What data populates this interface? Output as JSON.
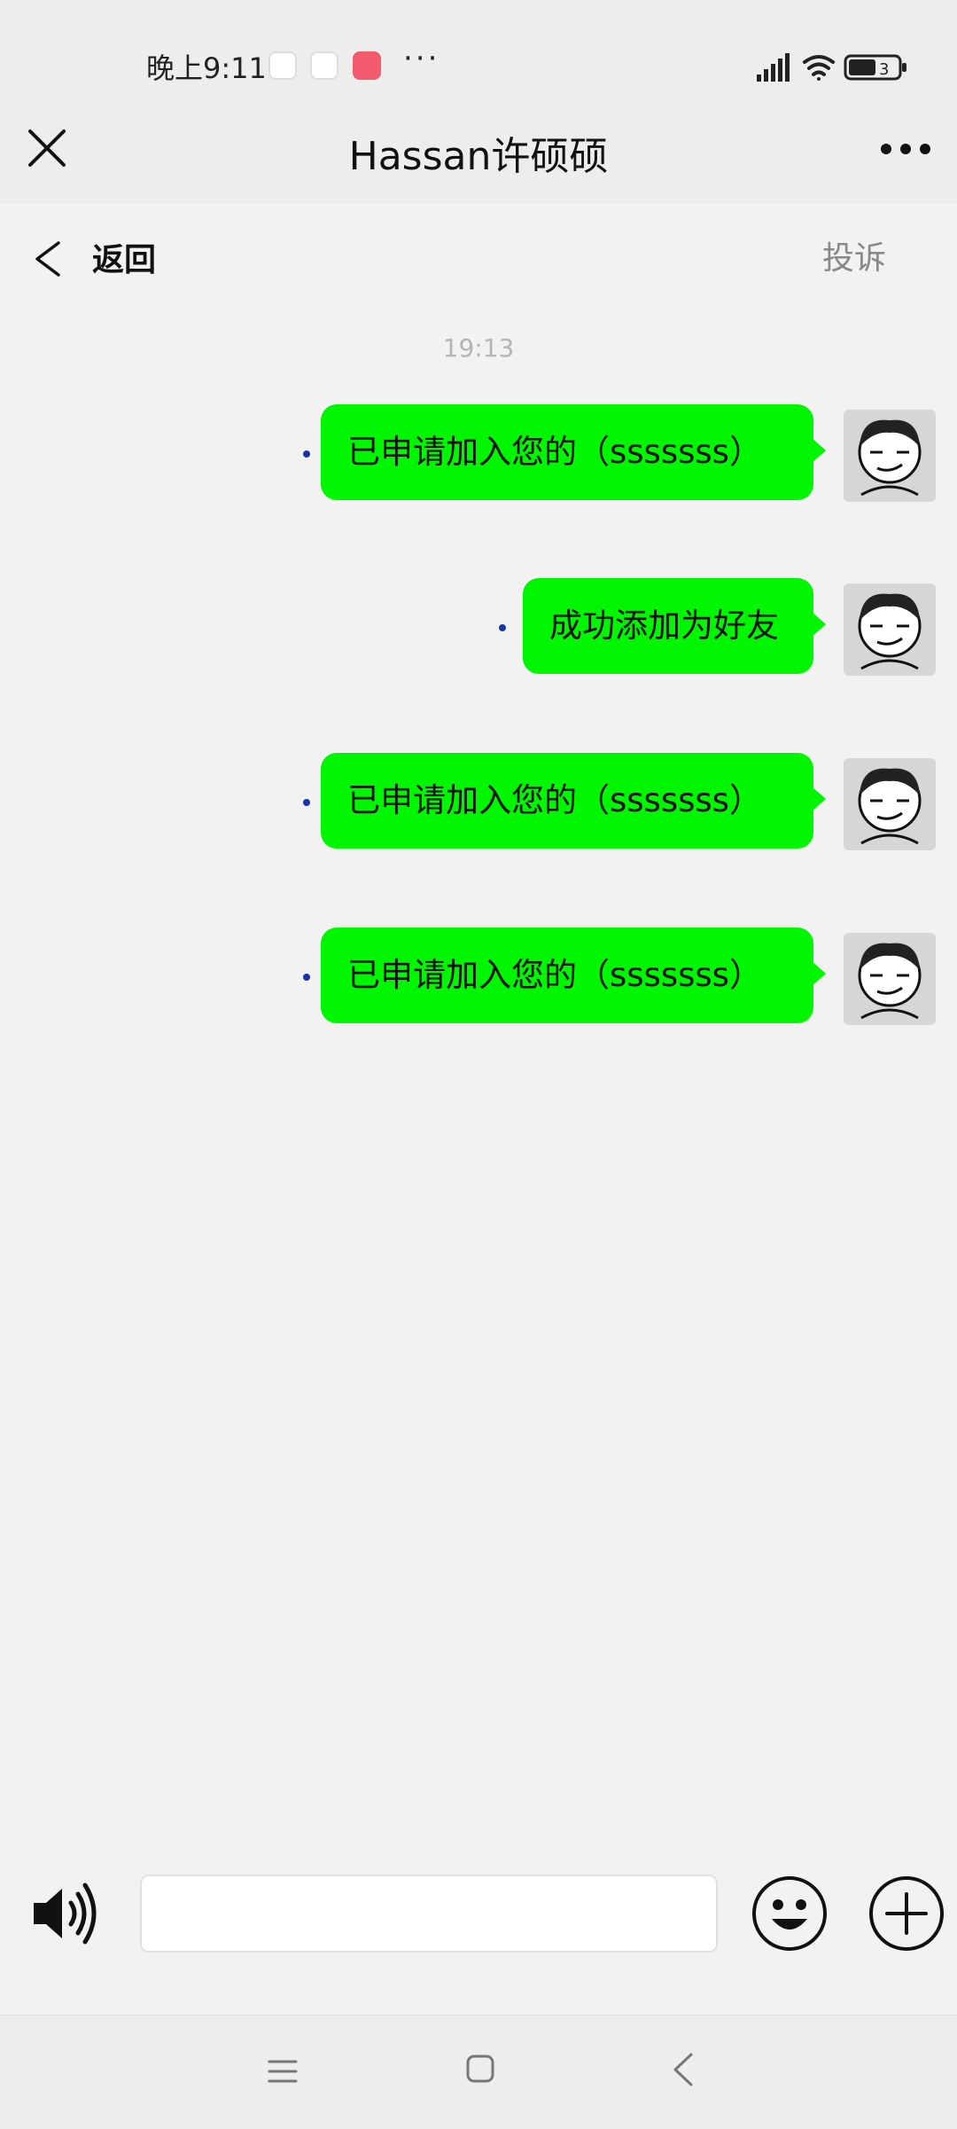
{
  "status_bar": {
    "time": "晚上9:11",
    "more": "···",
    "battery": "3",
    "icons": [
      "qq-icon",
      "app-icon",
      "app-red-icon",
      "signal-icon",
      "wifi-icon",
      "battery-icon"
    ]
  },
  "title_bar": {
    "title": "Hassan许硕硕",
    "close_icon": "close-icon",
    "more_icon": "more-icon"
  },
  "sub_bar": {
    "back_label": "返回",
    "report_label": "投诉"
  },
  "chat": {
    "timestamp": "19:13",
    "messages": [
      {
        "text": "已申请加入您的（sssssss）",
        "sender": "self"
      },
      {
        "text": "成功添加为好友",
        "sender": "self"
      },
      {
        "text": "已申请加入您的（sssssss）",
        "sender": "self"
      },
      {
        "text": "已申请加入您的（sssssss）",
        "sender": "self"
      }
    ]
  },
  "input_bar": {
    "value": "",
    "icons": [
      "voice-icon",
      "emoji-icon",
      "plus-icon"
    ]
  },
  "colors": {
    "bubble": "#00f500",
    "background": "#f3f2f3",
    "bar": "#ededed",
    "timestamp": "#b4b4b4",
    "status_dot": "#1b33a8"
  }
}
